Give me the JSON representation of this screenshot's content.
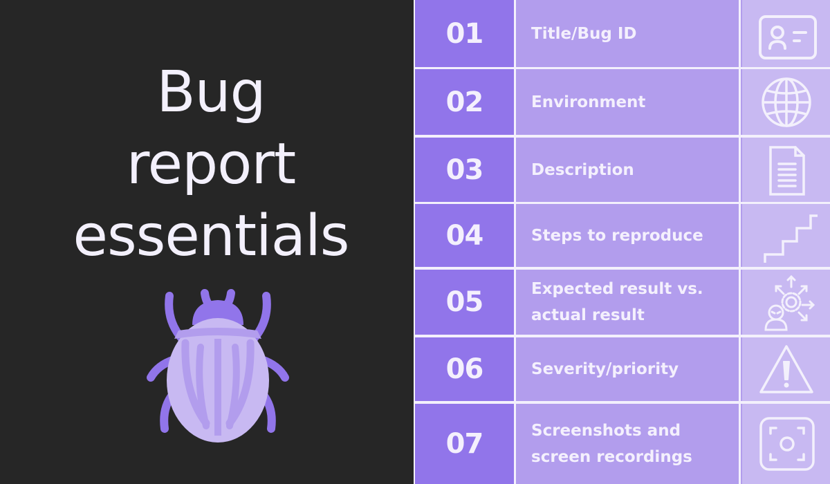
{
  "title": {
    "lines": [
      "Bug",
      "report",
      "essentials"
    ]
  },
  "colors": {
    "background": "#262626",
    "number_cell": "#9175ea",
    "label_cell": "#b29ded",
    "icon_cell": "#c8b9f2",
    "text": "#f3f0fc"
  },
  "items": [
    {
      "number": "01",
      "label": "Title/Bug ID",
      "icon": "id-card-icon"
    },
    {
      "number": "02",
      "label": "Environment",
      "icon": "globe-icon"
    },
    {
      "number": "03",
      "label": "Description",
      "icon": "document-icon"
    },
    {
      "number": "04",
      "label": "Steps to reproduce",
      "icon": "stairs-icon"
    },
    {
      "number": "05",
      "label": "Expected result vs. actual result",
      "icon": "person-gear-arrows-icon"
    },
    {
      "number": "06",
      "label": "Severity/priority",
      "icon": "warning-triangle-icon"
    },
    {
      "number": "07",
      "label": "Screenshots and screen recordings",
      "icon": "screenshot-camera-icon"
    }
  ]
}
